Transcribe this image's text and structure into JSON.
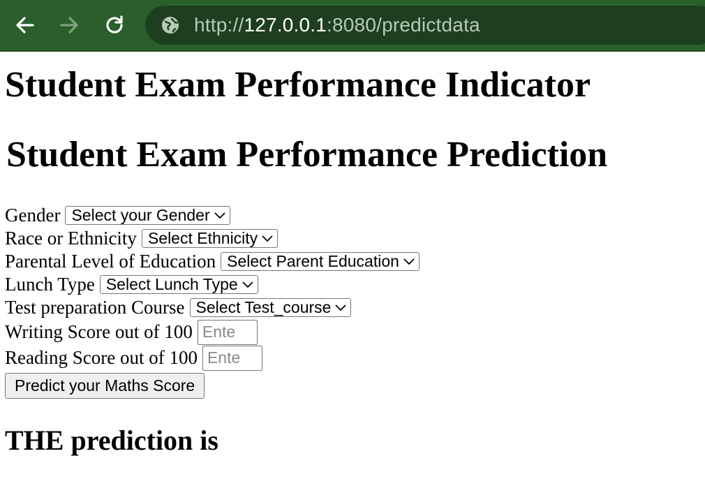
{
  "browser": {
    "url_scheme": "http://",
    "url_host": "127.0.0.1",
    "url_rest": ":8080/predictdata",
    "icons": {
      "back": "back-arrow-icon",
      "forward": "forward-arrow-icon",
      "reload": "reload-icon",
      "site": "globe-icon"
    },
    "colors": {
      "toolbar": "#2a5f2c",
      "omnibox": "#1d3f1f"
    }
  },
  "page": {
    "title": "Student Exam Performance Indicator",
    "subtitle": "Student Exam Performance Prediction"
  },
  "form": {
    "gender": {
      "label": "Gender",
      "selected": "Select your Gender"
    },
    "ethnicity": {
      "label": "Race or Ethnicity",
      "selected": "Select Ethnicity"
    },
    "parent_education": {
      "label": "Parental Level of Education",
      "selected": "Select Parent Education"
    },
    "lunch": {
      "label": "Lunch Type",
      "selected": "Select Lunch Type"
    },
    "test_course": {
      "label": "Test preparation Course",
      "selected": "Select Test_course"
    },
    "writing": {
      "label": "Writing Score out of 100",
      "placeholder": "Ente"
    },
    "reading": {
      "label": "Reading Score out of 100",
      "placeholder": "Ente"
    },
    "submit_label": "Predict your Maths Score"
  },
  "result": {
    "heading": "THE prediction is"
  }
}
